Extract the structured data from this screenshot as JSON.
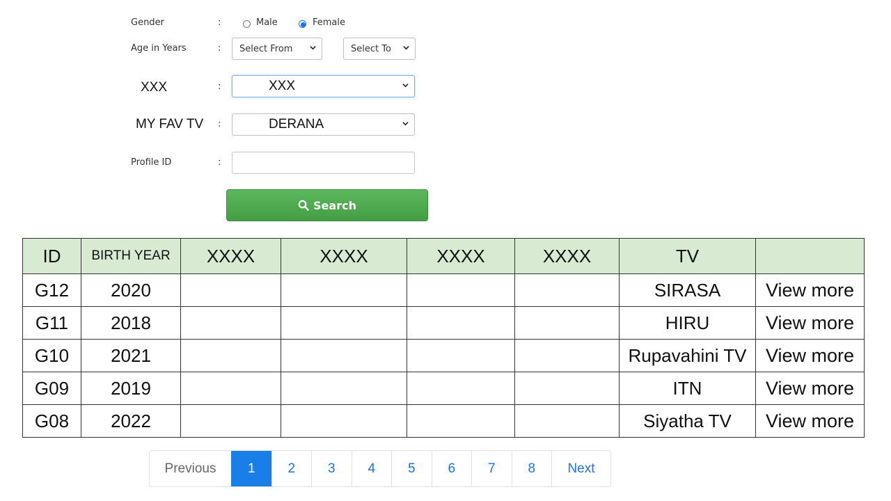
{
  "form": {
    "gender": {
      "label": "Gender",
      "colon": ":",
      "options": [
        "Male",
        "Female"
      ],
      "selected": "Female"
    },
    "age": {
      "label": "Age in Years",
      "colon": ":",
      "from_value": "Select From",
      "to_value": "Select To"
    },
    "xxx": {
      "label": "XXX",
      "colon": ":",
      "value": "XXX"
    },
    "fav_tv": {
      "label": "MY FAV TV",
      "colon": ":",
      "value": "DERANA"
    },
    "profile_id": {
      "label": "Profile ID",
      "colon": ":",
      "value": ""
    },
    "search_label": "Search"
  },
  "table": {
    "headers": [
      "ID",
      "BIRTH YEAR",
      "XXXX",
      "XXXX",
      "XXXX",
      "XXXX",
      "TV",
      ""
    ],
    "rows": [
      {
        "id": "G12",
        "birth_year": "2020",
        "tv": "SIRASA",
        "action": "View more"
      },
      {
        "id": "G11",
        "birth_year": "2018",
        "tv": "HIRU",
        "action": "View more"
      },
      {
        "id": "G10",
        "birth_year": "2021",
        "tv": "Rupavahini TV",
        "action": "View more"
      },
      {
        "id": "G09",
        "birth_year": "2019",
        "tv": "ITN",
        "action": "View more"
      },
      {
        "id": "G08",
        "birth_year": "2022",
        "tv": "Siyatha TV",
        "action": "View more"
      }
    ]
  },
  "pagination": {
    "previous": "Previous",
    "pages": [
      "1",
      "2",
      "3",
      "4",
      "5",
      "6",
      "7",
      "8"
    ],
    "active_page": "1",
    "next": "Next"
  },
  "colors": {
    "accent": "#1a7ee8",
    "search_green": "#4cae4c",
    "header_bg": "#d9ead3"
  }
}
